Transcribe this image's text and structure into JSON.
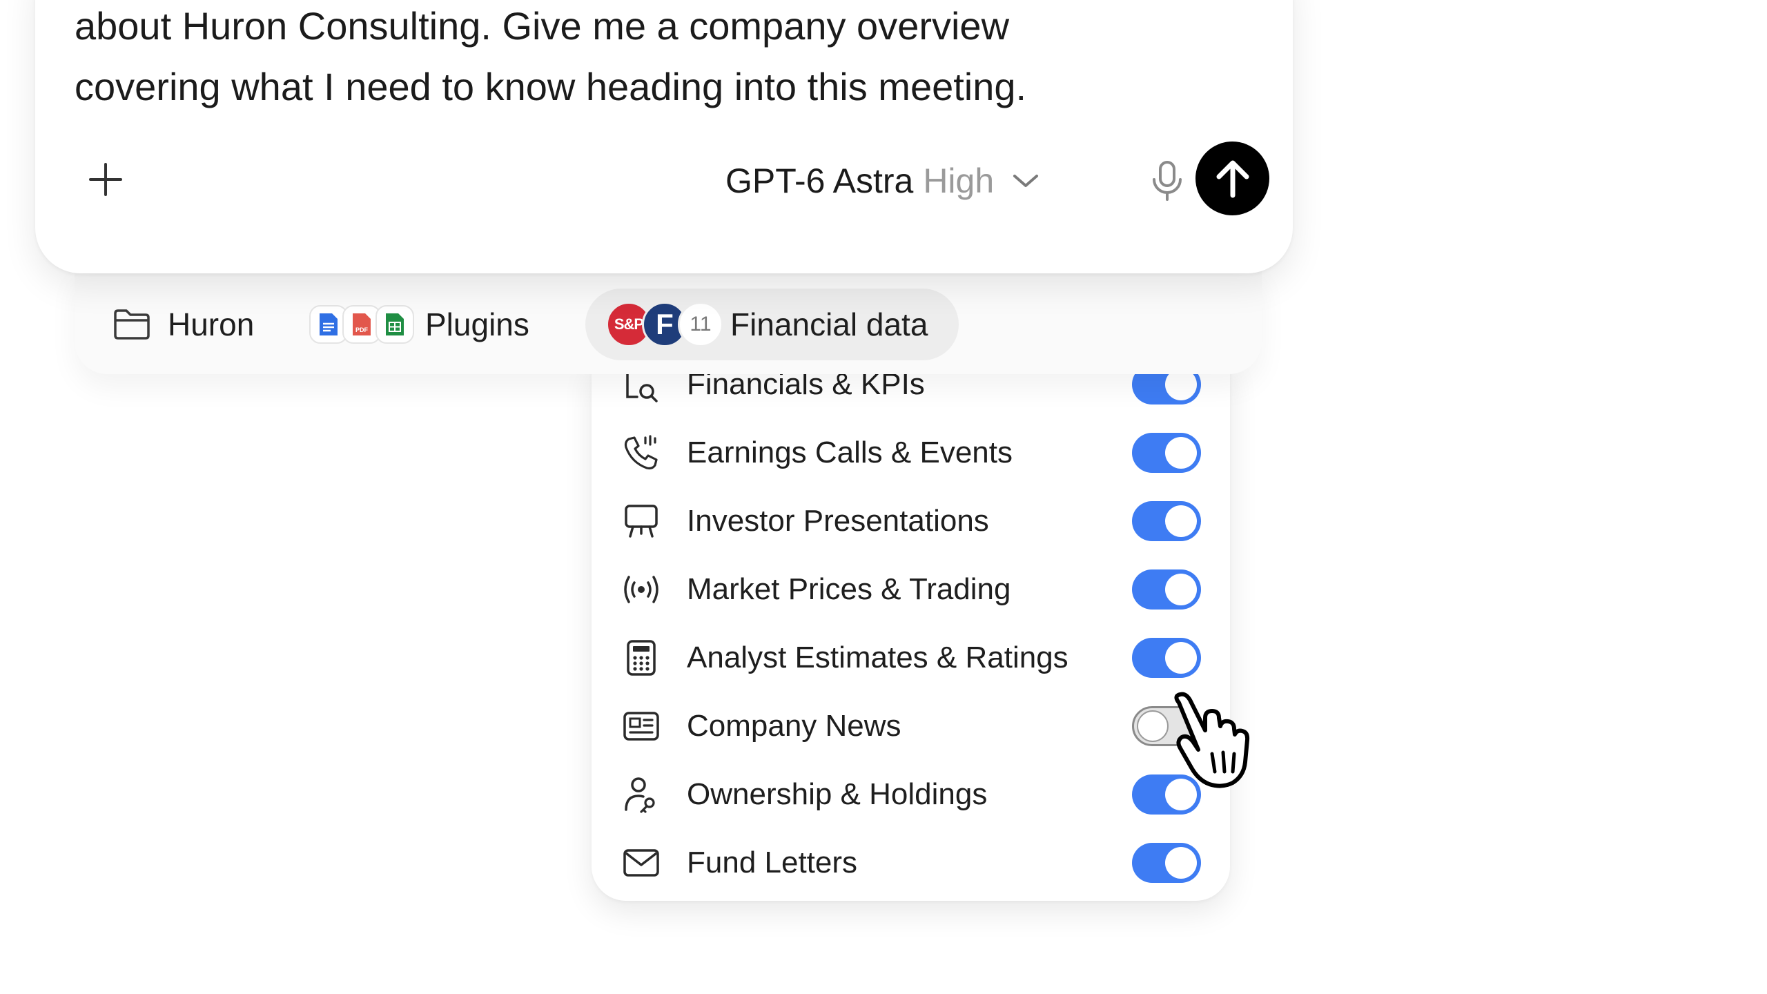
{
  "composer": {
    "prompt_text": "about Huron Consulting. Give me a company overview\ncovering what I need to know heading into this meeting.",
    "model_name": "GPT-6 Astra",
    "model_effort": "High"
  },
  "chips": {
    "project_label": "Huron",
    "plugins_label": "Plugins",
    "plugin_icons": [
      "docs-icon",
      "pdf-icon",
      "sheets-icon"
    ],
    "financial_label": "Financial data",
    "financial_logos": [
      "S&P",
      "F"
    ],
    "financial_count": "11"
  },
  "menu": {
    "items": [
      {
        "label": "Financials & KPIs",
        "icon": "search-document-icon",
        "enabled": true
      },
      {
        "label": "Earnings Calls & Events",
        "icon": "phone-call-icon",
        "enabled": true
      },
      {
        "label": "Investor Presentations",
        "icon": "presentation-icon",
        "enabled": true
      },
      {
        "label": "Market Prices & Trading",
        "icon": "broadcast-icon",
        "enabled": true
      },
      {
        "label": "Analyst Estimates & Ratings",
        "icon": "calculator-icon",
        "enabled": true
      },
      {
        "label": "Company News",
        "icon": "news-icon",
        "enabled": false
      },
      {
        "label": "Ownership & Holdings",
        "icon": "user-key-icon",
        "enabled": true
      },
      {
        "label": "Fund Letters",
        "icon": "mail-icon",
        "enabled": true
      }
    ]
  },
  "colors": {
    "toggle_on": "#3e7cf3",
    "toggle_off": "#e4e4e4",
    "send_button": "#000000",
    "sp_logo": "#d52b38",
    "f_logo": "#1f3d7a"
  }
}
